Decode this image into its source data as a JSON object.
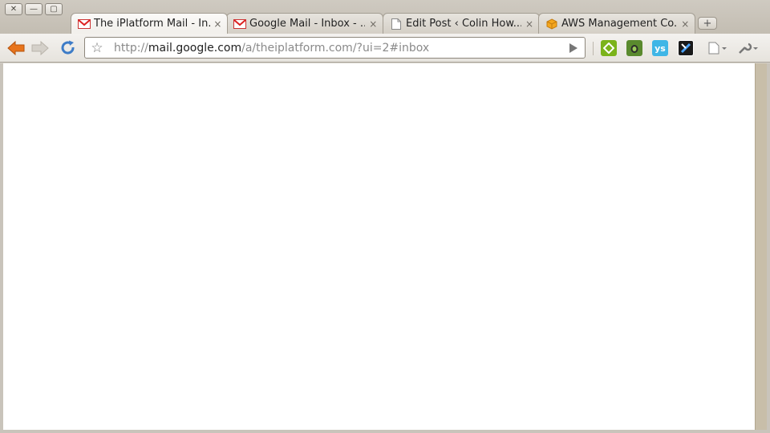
{
  "window": {
    "buttons": [
      "close",
      "minimize",
      "maximize"
    ]
  },
  "tabs": [
    {
      "title": "The iPlatform Mail - In...",
      "icon": "gmail-icon",
      "active": true
    },
    {
      "title": "Google Mail - Inbox - ...",
      "icon": "gmail-icon",
      "active": false
    },
    {
      "title": "Edit Post ‹ Colin How...",
      "icon": "page-icon",
      "active": false
    },
    {
      "title": "AWS Management Co...",
      "icon": "aws-icon",
      "active": false
    }
  ],
  "tab_close_glyph": "×",
  "new_tab_glyph": "+",
  "toolbar": {
    "url_scheme": "http://",
    "url_host": "mail.google.com",
    "url_path": "/a/theiplatform.com/?ui=2#inbox"
  },
  "extensions": [
    {
      "name": "feedly-icon",
      "color": "#7bb31a"
    },
    {
      "name": "evernote-icon",
      "color": "#5a8a2e"
    },
    {
      "name": "ys-icon",
      "color": "#3fb6e6",
      "label": "ys"
    },
    {
      "name": "delicious-icon",
      "color": "#1a1a1a"
    }
  ],
  "colors": {
    "accent_back": "#e8741c",
    "reload": "#3d7cc7",
    "scrollbar": "#c8bea9"
  }
}
